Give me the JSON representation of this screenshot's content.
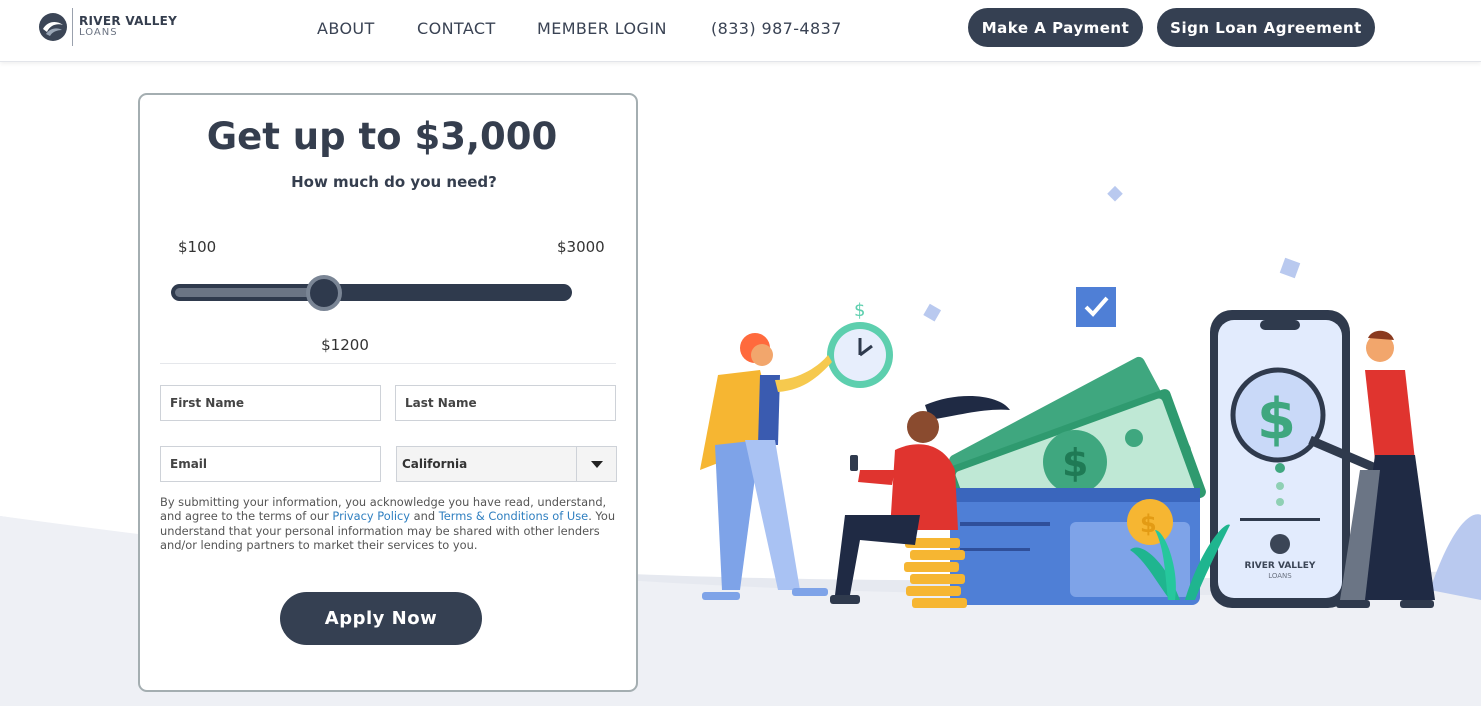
{
  "brand": {
    "name": "RIVER VALLEY",
    "sub": "LOANS"
  },
  "nav": {
    "about": "ABOUT",
    "contact": "CONTACT",
    "member_login": "MEMBER LOGIN",
    "phone": "(833) 987-4837"
  },
  "actions": {
    "payment": "Make A Payment",
    "sign": "Sign Loan Agreement"
  },
  "form": {
    "title": "Get up to $3,000",
    "subtitle": "How much do you need?",
    "slider": {
      "min_label": "$100",
      "max_label": "$3000",
      "value_label": "$1200",
      "min": 100,
      "max": 3000,
      "value": 1200
    },
    "first_name_placeholder": "First Name",
    "last_name_placeholder": "Last Name",
    "email_placeholder": "Email",
    "state_selected": "California",
    "disclaimer_1": "By submitting your information, you acknowledge you have read, understand, and agree to the terms of our ",
    "privacy_link": "Privacy Policy",
    "disclaimer_2": " and ",
    "terms_link": "Terms & Conditions of Use",
    "disclaimer_3": ". You understand that your personal information may be shared with other lenders and/or lending partners to market their services to you.",
    "apply_label": "Apply Now"
  },
  "illustration": {
    "phone_brand": "RIVER VALLEY",
    "phone_brand_sub": "LOANS"
  },
  "colors": {
    "primary": "#354052",
    "link": "#2f7fc0",
    "money_green": "#3fa77f",
    "wallet_blue": "#4f7fd6"
  }
}
